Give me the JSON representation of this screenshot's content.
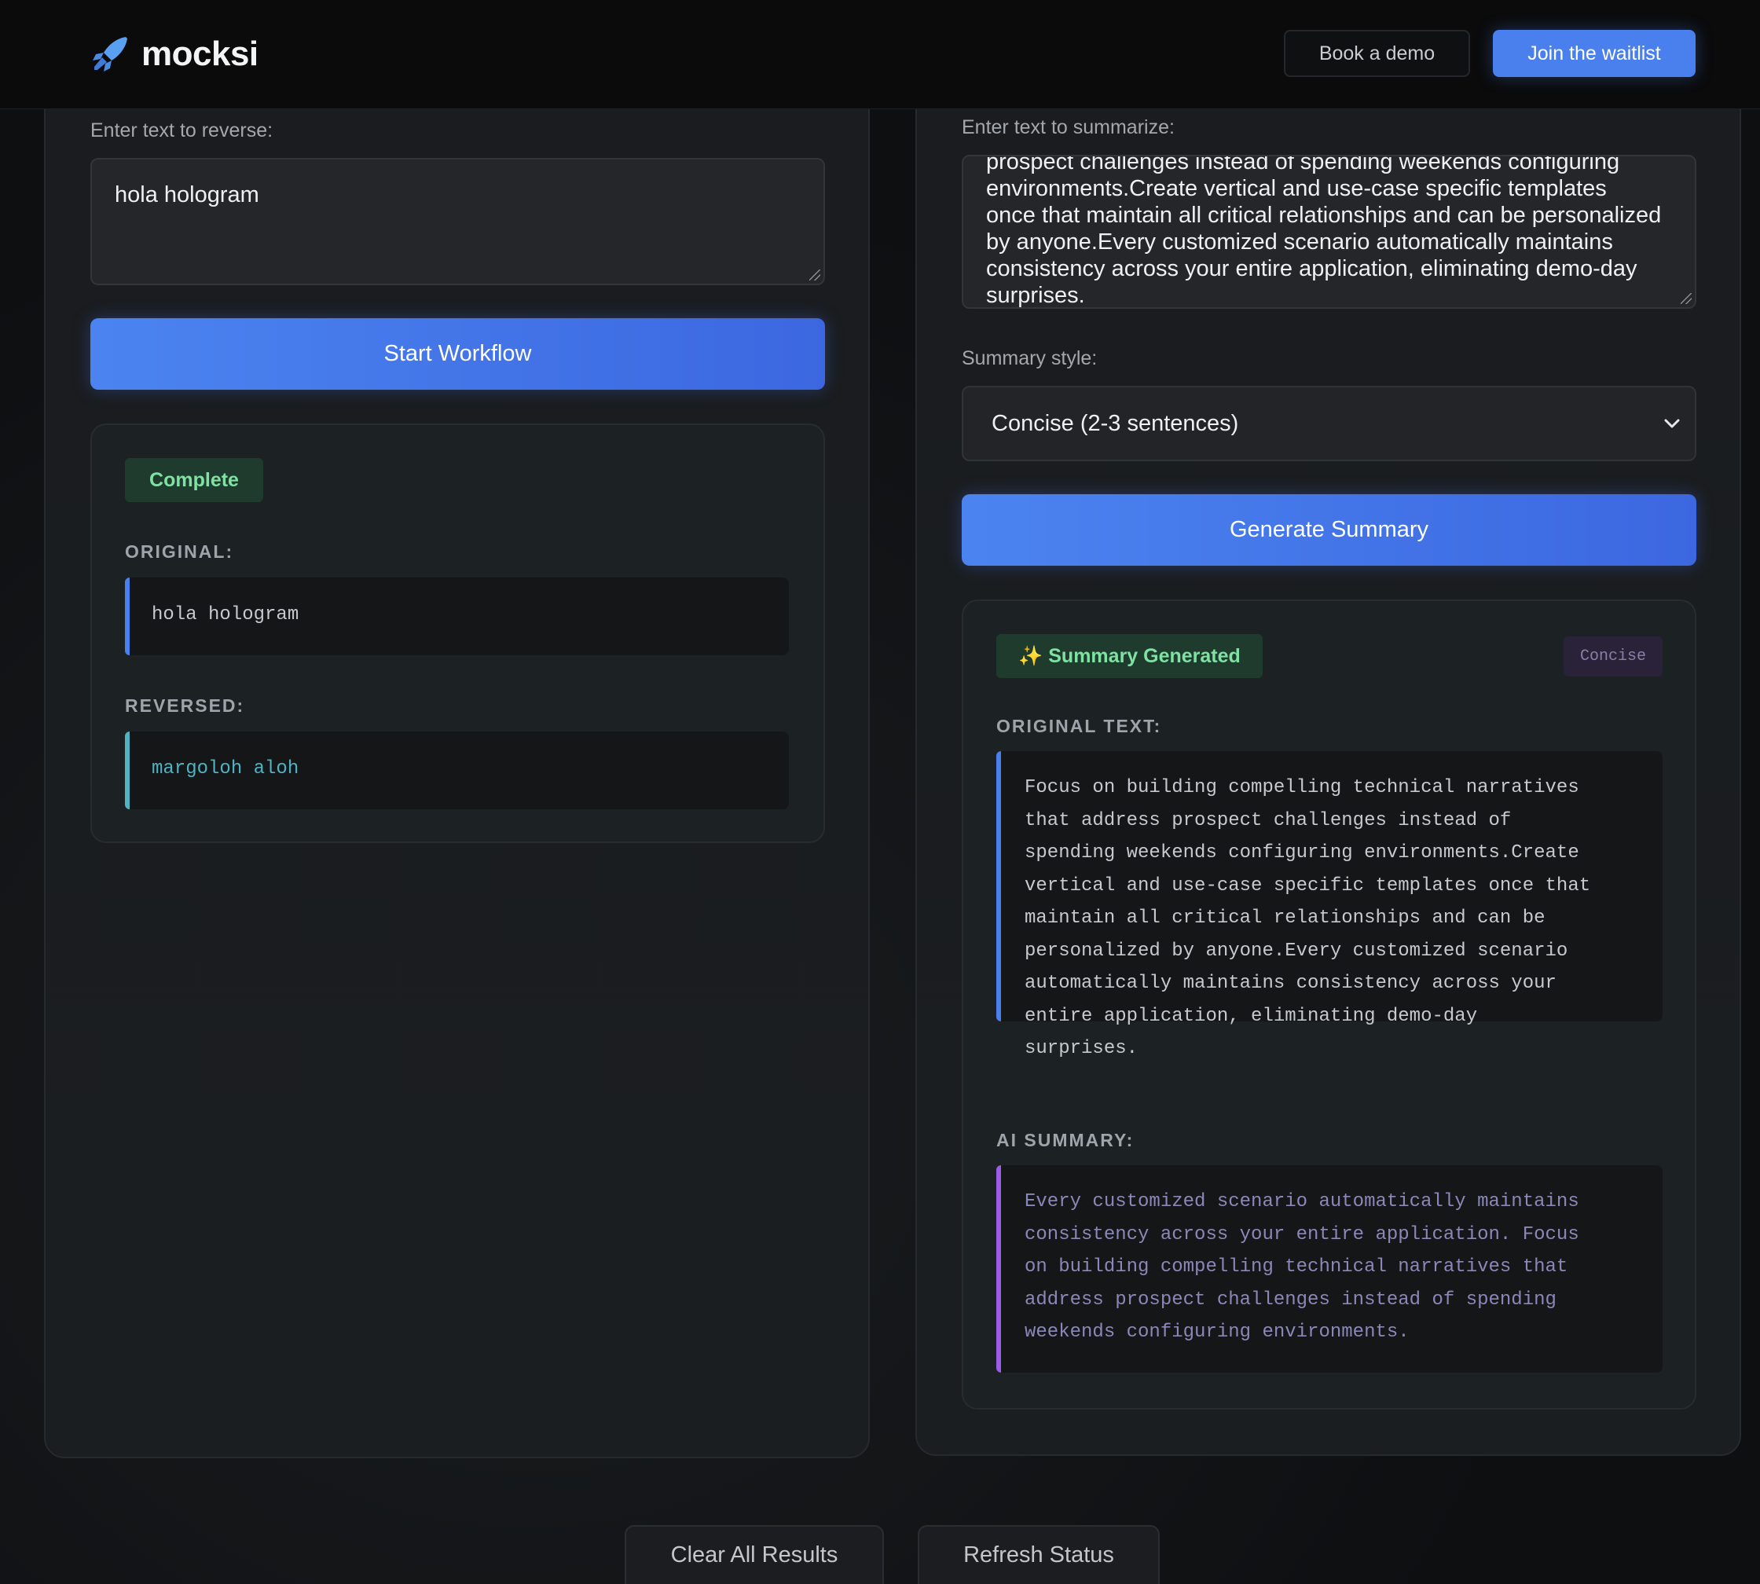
{
  "header": {
    "brand": "mocksi",
    "book_demo_label": "Book a demo",
    "waitlist_label": "Join the waitlist",
    "accent_color": "#4a80ee"
  },
  "reverse_panel": {
    "input_label": "Enter text to reverse:",
    "input_value": "hola hologram",
    "start_button_label": "Start Workflow",
    "status_badge": "Complete",
    "original_heading": "ORIGINAL:",
    "original_value": "hola hologram",
    "reversed_heading": "REVERSED:",
    "reversed_value": "margoloh aloh"
  },
  "summary_panel": {
    "input_label": "Enter text to summarize:",
    "input_visible_lines": [
      "prospect challenges instead of spending weekends configuring",
      "environments.Create vertical and use-case specific templates",
      "once that maintain all critical relationships and can be personalized",
      "by anyone.Every customized scenario automatically maintains",
      "consistency across your entire application, eliminating demo-day",
      "surprises."
    ],
    "style_label": "Summary style:",
    "style_selected": "Concise (2-3 sentences)",
    "generate_button_label": "Generate Summary",
    "status_badge": "✨ Summary Generated",
    "mode_badge": "Concise",
    "original_heading": "ORIGINAL TEXT:",
    "original_lines": [
      "Focus on building compelling technical narratives",
      "that address prospect challenges instead of",
      "spending weekends configuring environments.Create",
      "vertical and use-case specific templates once that",
      "maintain all critical relationships and can be",
      "personalized by anyone.Every customized scenario",
      "automatically maintains consistency across your",
      "entire application, eliminating demo-day",
      "surprises."
    ],
    "summary_heading": "AI SUMMARY:",
    "summary_lines": [
      "Every customized scenario automatically maintains",
      "consistency across your entire application. Focus",
      "on building compelling technical narratives that",
      "address prospect challenges instead of spending",
      "weekends configuring environments."
    ]
  },
  "footer": {
    "clear_label": "Clear All Results",
    "refresh_label": "Refresh Status"
  },
  "colors": {
    "accent_blue": "#4a80ee",
    "success_green": "#7fe1a2",
    "cyan_output": "#4fb3c4",
    "purple_bar": "#9b5de5",
    "summary_text": "#8a88b8"
  }
}
